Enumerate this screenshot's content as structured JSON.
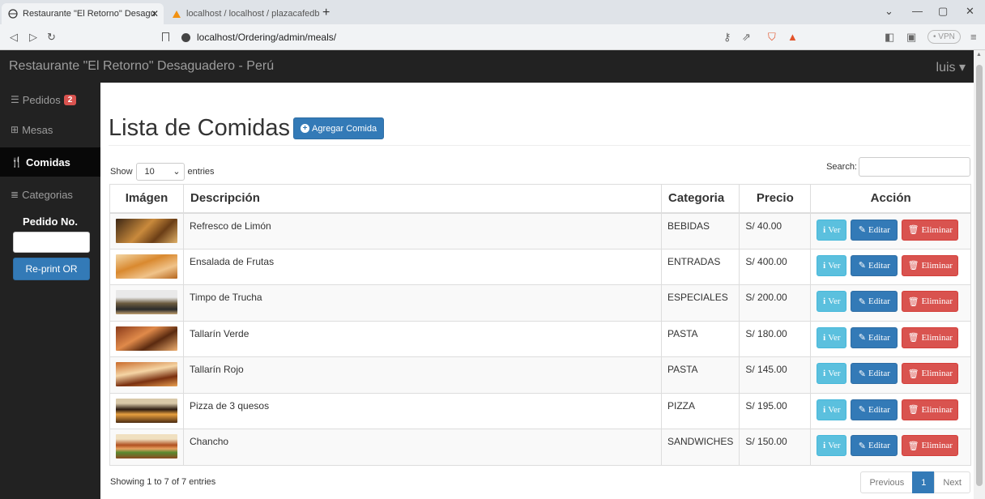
{
  "browser": {
    "tabs": [
      {
        "title": "Restaurante \"El Retorno\" Desagu"
      },
      {
        "title": "localhost / localhost / plazacafedb / t:"
      }
    ],
    "url": "localhost/Ordering/admin/meals/",
    "vpn_label": "• VPN"
  },
  "app": {
    "brand": "Restaurante \"El Retorno\" Desaguadero - Perú",
    "user": "luis ▾"
  },
  "sidebar": {
    "items": [
      {
        "label": "Pedidos",
        "icon": "list-icon"
      },
      {
        "label": "Mesas",
        "icon": "table-icon"
      },
      {
        "label": "Comidas",
        "icon": "cutlery-icon"
      },
      {
        "label": "Categorias",
        "icon": "menu-lines-icon"
      }
    ],
    "pedidos_badge": "2",
    "pedido_label": "Pedido No.",
    "pedido_value": "",
    "reprint_label": "Re-print OR"
  },
  "main": {
    "title": "Lista de Comidas",
    "add_label": "Agregar Comida",
    "show_label": "Show",
    "entries_value": "10",
    "entries_label": "entries",
    "search_label": "Search:",
    "search_value": "",
    "columns": [
      "Imágen",
      "Descripción",
      "Categoria",
      "Precio",
      "Acción"
    ],
    "rows": [
      {
        "desc": "Refresco de Limón",
        "cat": "BEBIDAS",
        "price": "S/ 40.00"
      },
      {
        "desc": "Ensalada de Frutas",
        "cat": "ENTRADAS",
        "price": "S/ 400.00"
      },
      {
        "desc": "Timpo de Trucha",
        "cat": "ESPECIALES",
        "price": "S/ 200.00"
      },
      {
        "desc": "Tallarín Verde",
        "cat": "PASTA",
        "price": "S/ 180.00"
      },
      {
        "desc": "Tallarín Rojo",
        "cat": "PASTA",
        "price": "S/ 145.00"
      },
      {
        "desc": "Pizza de 3 quesos",
        "cat": "PIZZA",
        "price": "S/ 195.00"
      },
      {
        "desc": "Chancho",
        "cat": "SANDWICHES",
        "price": "S/ 150.00"
      }
    ],
    "actions": {
      "view": "Ver",
      "edit": "Editar",
      "delete": "Eliminar"
    },
    "info": "Showing 1 to 7 of 7 entries",
    "pager": {
      "prev": "Previous",
      "current": "1",
      "next": "Next"
    }
  },
  "colors": {
    "navbar": "#222222",
    "primary": "#337ab7",
    "info": "#5bc0de",
    "danger": "#d9534f"
  }
}
